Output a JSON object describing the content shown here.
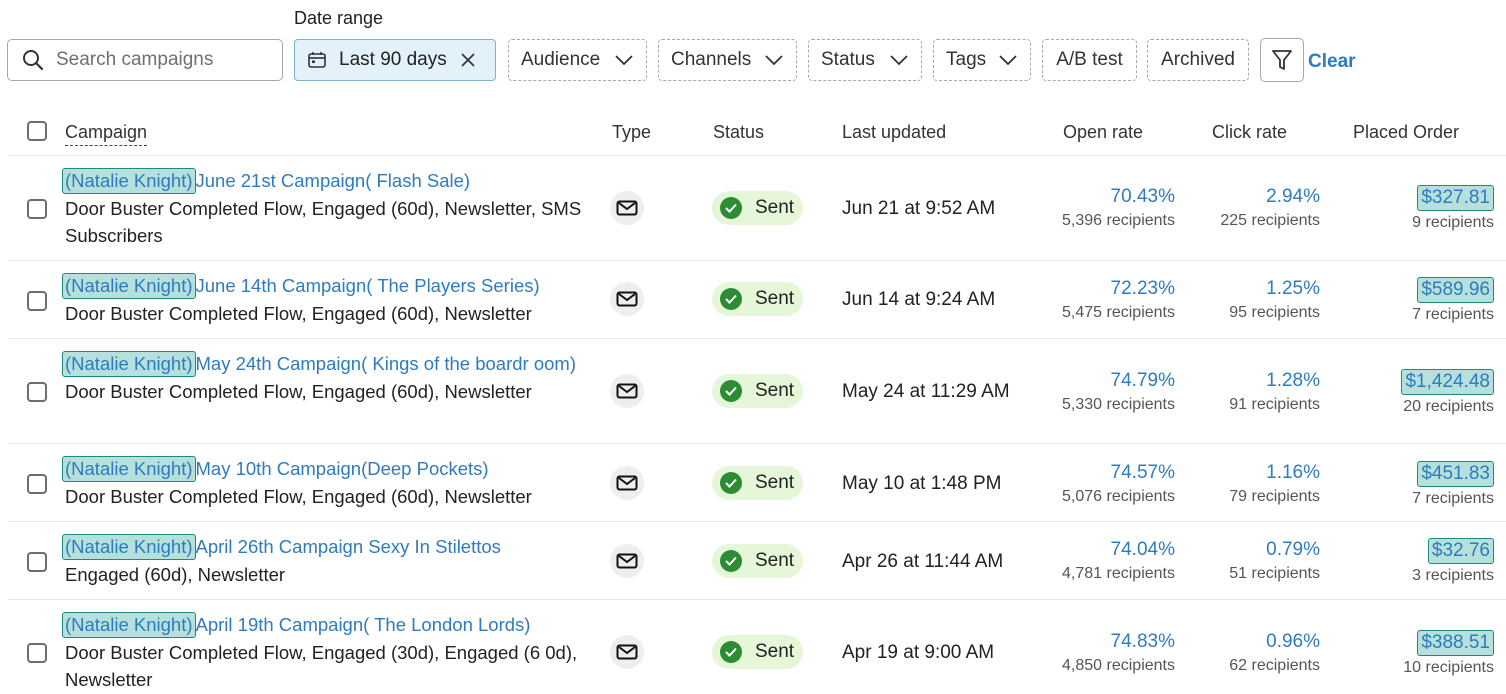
{
  "filters": {
    "date_range_label": "Date range",
    "search_placeholder": "Search campaigns",
    "date_value": "Last 90 days",
    "audience": "Audience",
    "channels": "Channels",
    "status": "Status",
    "tags": "Tags",
    "ab_test": "A/B test",
    "archived": "Archived",
    "clear": "Clear"
  },
  "table": {
    "headers": {
      "campaign": "Campaign",
      "type": "Type",
      "status": "Status",
      "last_updated": "Last updated",
      "open_rate": "Open rate",
      "click_rate": "Click rate",
      "placed_order": "Placed Order"
    },
    "rows": [
      {
        "owner": "(Natalie Knight)",
        "name": "June 21st Campaign( Flash Sale)",
        "audiences": "Door Buster Completed Flow, Engaged (60d), Newsletter, SMS Subscribers",
        "type_icon": "mail-icon",
        "status": "Sent",
        "updated": "Jun 21 at 9:52 AM",
        "open_rate": "70.43%",
        "open_recipients": "5,396 recipients",
        "click_rate": "2.94%",
        "click_recipients": "225 recipients",
        "order_value": "$327.81",
        "order_recipients": "9 recipients"
      },
      {
        "owner": "(Natalie Knight)",
        "name": "June 14th Campaign( The Players Series)",
        "audiences": "Door Buster Completed Flow, Engaged (60d), Newsletter",
        "type_icon": "mail-icon",
        "status": "Sent",
        "updated": "Jun 14 at 9:24 AM",
        "open_rate": "72.23%",
        "open_recipients": "5,475 recipients",
        "click_rate": "1.25%",
        "click_recipients": "95 recipients",
        "order_value": "$589.96",
        "order_recipients": "7 recipients"
      },
      {
        "owner": "(Natalie Knight)",
        "name": "May 24th Campaign( Kings of the boardr oom)",
        "audiences": "Door Buster Completed Flow, Engaged (60d), Newsletter",
        "type_icon": "mail-icon",
        "status": "Sent",
        "updated": "May 24 at 11:29 AM",
        "open_rate": "74.79%",
        "open_recipients": "5,330 recipients",
        "click_rate": "1.28%",
        "click_recipients": "91 recipients",
        "order_value": "$1,424.48",
        "order_recipients": "20 recipients"
      },
      {
        "owner": "(Natalie Knight)",
        "name": "May 10th Campaign(Deep Pockets)",
        "audiences": "Door Buster Completed Flow, Engaged (60d), Newsletter",
        "type_icon": "mail-icon",
        "status": "Sent",
        "updated": "May 10 at 1:48 PM",
        "open_rate": "74.57%",
        "open_recipients": "5,076 recipients",
        "click_rate": "1.16%",
        "click_recipients": "79 recipients",
        "order_value": "$451.83",
        "order_recipients": "7 recipients"
      },
      {
        "owner": "(Natalie Knight)",
        "name": "April 26th Campaign Sexy In Stilettos",
        "audiences": "Engaged (60d), Newsletter",
        "type_icon": "mail-icon",
        "status": "Sent",
        "updated": "Apr 26 at 11:44 AM",
        "open_rate": "74.04%",
        "open_recipients": "4,781 recipients",
        "click_rate": "0.79%",
        "click_recipients": "51 recipients",
        "order_value": "$32.76",
        "order_recipients": "3 recipients"
      },
      {
        "owner": "(Natalie Knight)",
        "name": "April 19th Campaign( The London Lords)",
        "audiences": "Door Buster Completed Flow, Engaged (30d), Engaged (6 0d), Newsletter",
        "type_icon": "mail-icon",
        "status": "Sent",
        "updated": "Apr 19 at 9:00 AM",
        "open_rate": "74.83%",
        "open_recipients": "4,850 recipients",
        "click_rate": "0.96%",
        "click_recipients": "62 recipients",
        "order_value": "$388.51",
        "order_recipients": "10 recipients"
      }
    ]
  },
  "colors": {
    "link": "#2f7bbf",
    "sent_bg": "#e6f7d9",
    "sent_check": "#2b8c33",
    "highlight": "#b6e0dc"
  }
}
